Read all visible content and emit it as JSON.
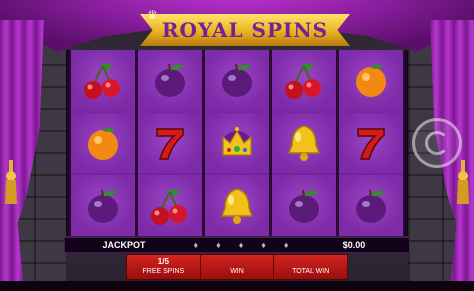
{
  "game": {
    "title": "ROYAL SPINS"
  },
  "reels": [
    [
      "cherry",
      "orange",
      "plum"
    ],
    [
      "plum",
      "seven",
      "cherry"
    ],
    [
      "plum",
      "crown",
      "bell"
    ],
    [
      "cherry",
      "bell",
      "plum"
    ],
    [
      "orange",
      "seven",
      "plum"
    ]
  ],
  "jackpot": {
    "label": "JACKPOT",
    "value": "$0.00",
    "icons": [
      "bell-icon",
      "bell-icon",
      "bell-icon",
      "bell-icon",
      "bell-icon"
    ]
  },
  "stats": {
    "free_spins_value": "1/5",
    "free_spins_label": "FREE SPINS",
    "win_value": "",
    "win_label": "WIN",
    "total_win_value": "",
    "total_win_label": "TOTAL WIN"
  },
  "colors": {
    "curtain": "#b737cf",
    "reel_bg": "#7d2ba9",
    "stats_bar": "#d2241e",
    "logo_gold": "#e8b320"
  }
}
